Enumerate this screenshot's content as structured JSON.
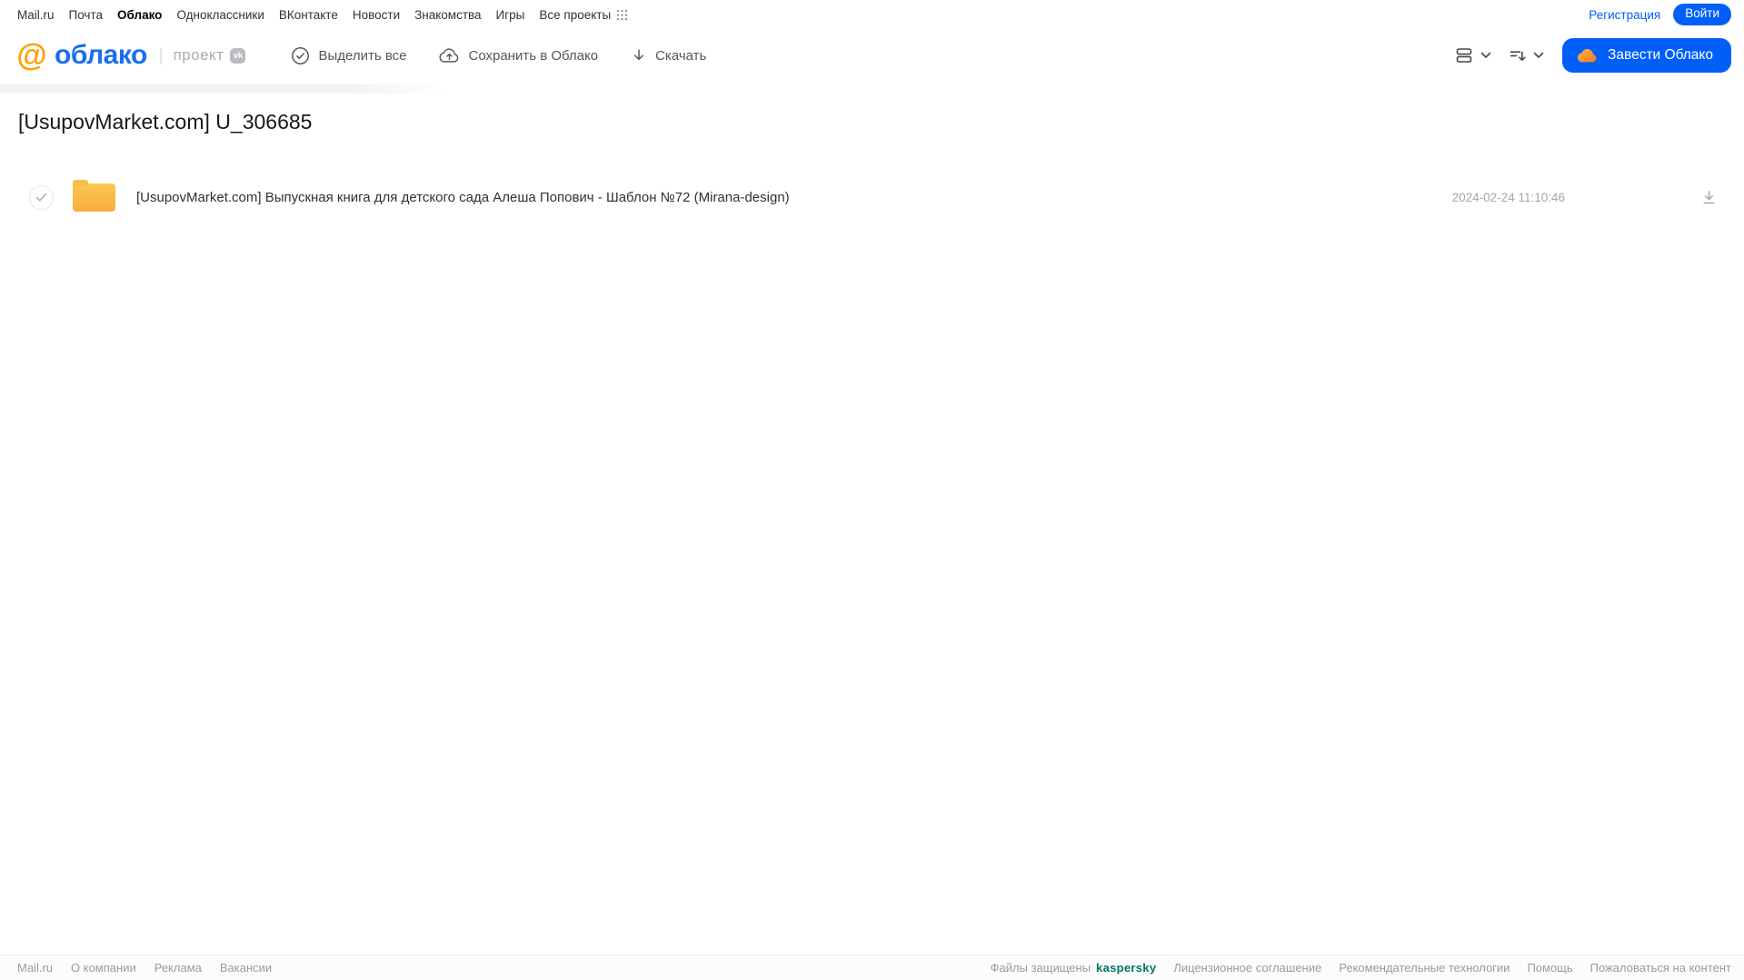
{
  "top_nav": {
    "items": [
      "Mail.ru",
      "Почта",
      "Облако",
      "Одноклассники",
      "ВКонтакте",
      "Новости",
      "Знакомства",
      "Игры",
      "Все проекты"
    ],
    "registration_label": "Регистрация",
    "login_label": "Войти"
  },
  "header": {
    "logo_at": "@",
    "logo_text": "облако",
    "divider": "|",
    "project_label": "проект",
    "vk_badge": "vk",
    "toolbar": {
      "select_all": "Выделить все",
      "save_to_cloud": "Сохранить в Облако",
      "download": "Скачать"
    },
    "get_cloud_button": "Завести Облако"
  },
  "main": {
    "title": "[UsupovMarket.com] U_306685",
    "files": [
      {
        "name": "[UsupovMarket.com] Выпускная книга для детского сада Алеша Попович - Шаблон №72 (Mirana-design)",
        "date": "2024-02-24 11:10:46"
      }
    ]
  },
  "footer": {
    "links_left": [
      "Mail.ru",
      "О компании",
      "Реклама",
      "Вакансии"
    ],
    "protected_label": "Файлы защищены",
    "kaspersky_label": "kaspersky",
    "links_right": [
      "Лицензионное соглашение",
      "Рекомендательные технологии",
      "Помощь",
      "Пожаловаться на контент"
    ]
  },
  "colors": {
    "accent_blue": "#005ff9",
    "logo_blue": "#1b6ff0",
    "logo_orange": "#ff9f00",
    "folder_yellow": "#f8b84a",
    "kaspersky_green": "#00755f"
  }
}
